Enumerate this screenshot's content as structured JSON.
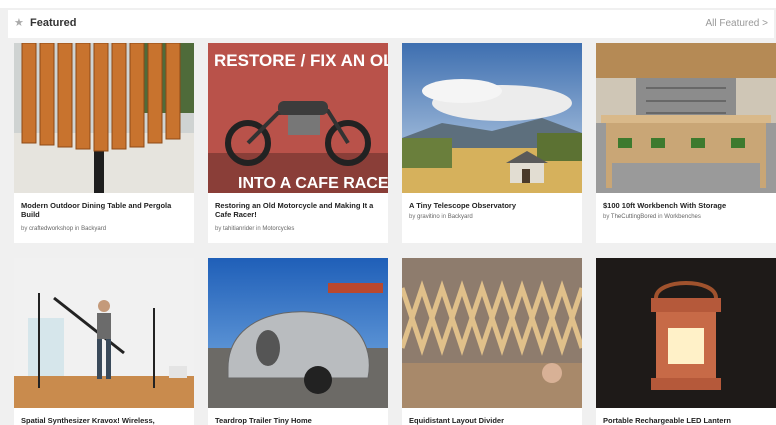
{
  "header": {
    "title": "Featured",
    "all_link": "All Featured >",
    "star_icon": "star-icon"
  },
  "cards": [
    {
      "title": "Modern Outdoor Dining Table and Pergola Build",
      "author": "craftedworkshop",
      "category": "Backyard"
    },
    {
      "title": "Restoring an Old Motorcycle and Making It a Cafe Racer!",
      "author": "tahitianrider",
      "category": "Motorcycles",
      "image_text_top": "RESTORE / FIX AN OLD BIKE",
      "image_text_bottom": "INTO A CAFE RACER"
    },
    {
      "title": "A Tiny Telescope Observatory",
      "author": "gravitino",
      "category": "Backyard"
    },
    {
      "title": "$100 10ft Workbench With Storage",
      "author": "TheCuttingBored",
      "category": "Workbenches"
    },
    {
      "title": "Spatial Synthesizer Kravox! Wireless,",
      "author": "",
      "category": ""
    },
    {
      "title": "Teardrop Trailer Tiny Home",
      "author": "",
      "category": ""
    },
    {
      "title": "Equidistant Layout Divider",
      "author": "",
      "category": ""
    },
    {
      "title": "Portable Rechargeable LED Lantern",
      "author": "",
      "category": ""
    }
  ],
  "labels": {
    "by": "by",
    "in": "in"
  }
}
